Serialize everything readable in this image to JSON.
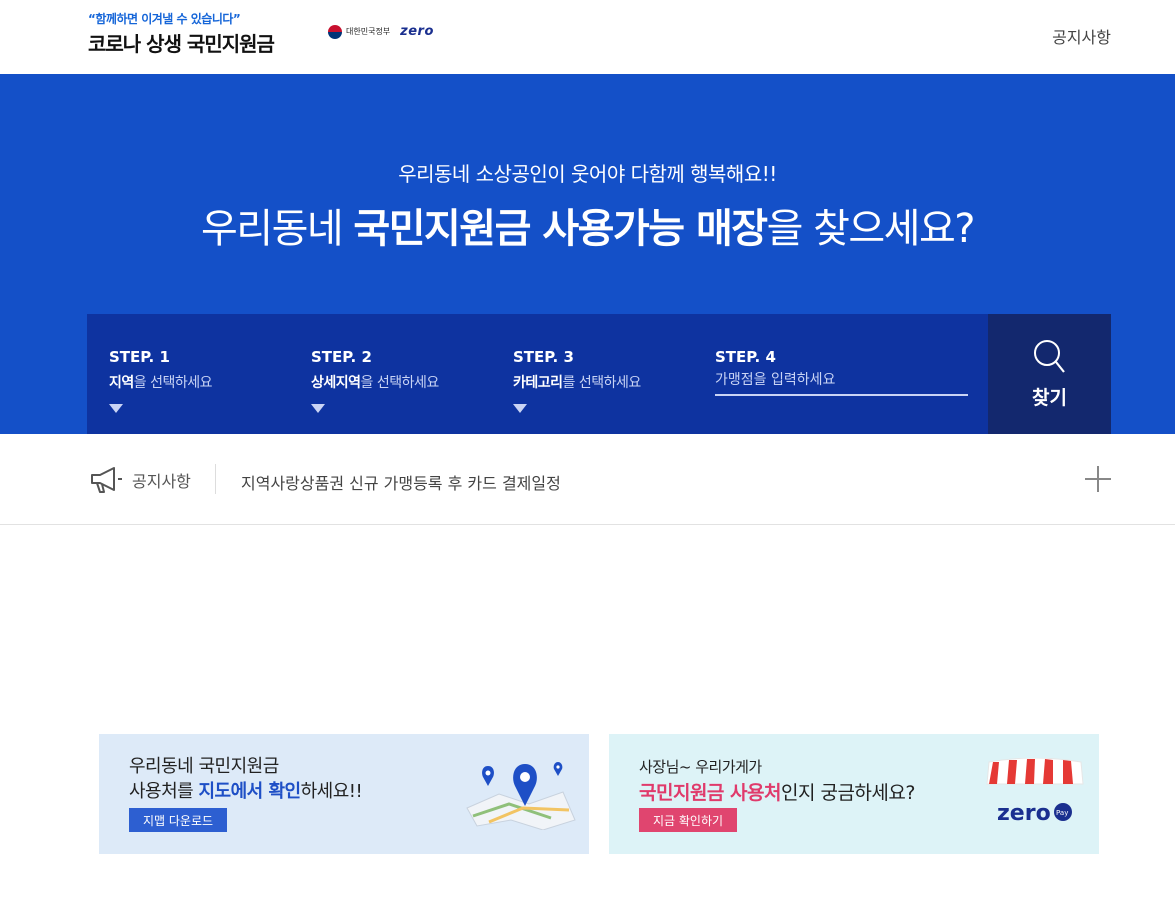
{
  "header": {
    "tagline": "“함께하면 이겨낼 수 있습니다”",
    "brand": "코로나 상생 국민지원금",
    "gov_label": "대한민국정부",
    "zero_label": "zero",
    "nav_notice": "공지사항"
  },
  "hero": {
    "subtitle": "우리동네 소상공인이 웃어야 다함께 행복해요!!",
    "title_pre": "우리동네 ",
    "title_bold": "국민지원금 사용가능 매장",
    "title_post": "을 찾으세요?"
  },
  "steps": [
    {
      "label": "STEP. 1",
      "desc_bold": "지역",
      "desc_rest": "을 선택하세요"
    },
    {
      "label": "STEP. 2",
      "desc_bold": "상세지역",
      "desc_rest": "을 선택하세요"
    },
    {
      "label": "STEP. 3",
      "desc_bold": "카테고리",
      "desc_rest": "를 선택하세요"
    },
    {
      "label": "STEP. 4",
      "placeholder": "가맹점을 입력하세요",
      "value": ""
    }
  ],
  "search": {
    "label": "찾기"
  },
  "notice": {
    "label": "공지사항",
    "text": "지역사랑상품권 신규 가맹등록 후 카드 결제일정"
  },
  "banners": {
    "map": {
      "line1": "우리동네 국민지원금",
      "line2_pre": "사용처를 ",
      "line2_bold": "지도에서 확인",
      "line2_post": "하세요!!",
      "button": "지맵 다운로드"
    },
    "zero": {
      "line1": "사장님~ 우리가게가",
      "line2_bold": "국민지원금 사용처",
      "line2_post": "인지 궁금하세요?",
      "button": "지금 확인하기",
      "logo": "zero",
      "logo_pay": "Pay"
    }
  },
  "colors": {
    "hero_bg": "#1450c8",
    "steps_bg": "#0e33a0",
    "search_bg": "#13286e",
    "accent_blue": "#1e4fc6",
    "accent_pink": "#e03a6b"
  }
}
